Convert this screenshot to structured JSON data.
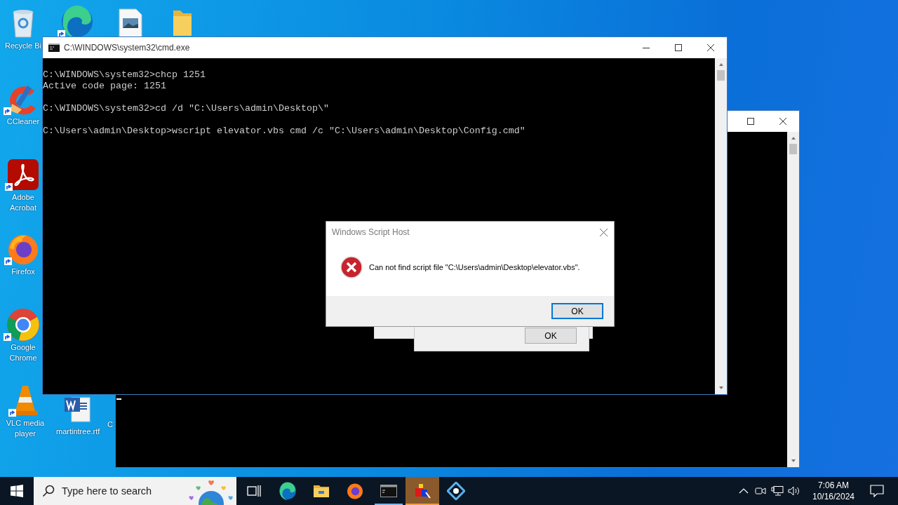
{
  "desktop_icons": [
    {
      "kind": "recycle-bin",
      "label": "Recycle Bi"
    },
    {
      "kind": "edge",
      "shortcut": true
    },
    {
      "kind": "image-file"
    },
    {
      "kind": "folder"
    },
    {
      "kind": "ccleaner",
      "label": "CCleaner",
      "shortcut": true
    },
    {
      "kind": "acrobat",
      "label": "Adobe Acrobat",
      "shortcut": true
    },
    {
      "kind": "firefox",
      "label": "Firefox",
      "shortcut": true
    },
    {
      "kind": "chrome",
      "label": "Google Chrome",
      "shortcut": true
    },
    {
      "kind": "vlc",
      "label": "VLC media player",
      "shortcut": true
    },
    {
      "kind": "word-file",
      "label": "martintree.rtf"
    },
    {
      "kind": "covered",
      "label": "C"
    }
  ],
  "cmd_window": {
    "title": "C:\\WINDOWS\\system32\\cmd.exe",
    "blocks": [
      [
        "C:\\WINDOWS\\system32>chcp 1251",
        "Active code page: 1251"
      ],
      [
        "C:\\WINDOWS\\system32>cd /d \"C:\\Users\\admin\\Desktop\\\""
      ],
      [
        "C:\\Users\\admin\\Desktop>wscript elevator.vbs cmd /c \"C:\\Users\\admin\\Desktop\\Config.cmd\""
      ]
    ]
  },
  "background_dialog": {
    "button": "OK"
  },
  "dialog": {
    "title": "Windows Script Host",
    "message": "Can not find script file \"C:\\Users\\admin\\Desktop\\elevator.vbs\".",
    "button": "OK"
  },
  "taskbar": {
    "search": {
      "placeholder": "Type here to search"
    },
    "apps": [
      {
        "kind": "task-view",
        "running": false,
        "selected": false
      },
      {
        "kind": "edge",
        "running": false,
        "selected": false
      },
      {
        "kind": "explorer",
        "running": false,
        "selected": false
      },
      {
        "kind": "firefox",
        "running": false,
        "selected": false
      },
      {
        "kind": "terminal",
        "running": true,
        "selected": false
      },
      {
        "kind": "blocks",
        "running": true,
        "selected": true
      },
      {
        "kind": "network-app",
        "running": false,
        "selected": false
      }
    ],
    "clock": {
      "time": "7:06 AM",
      "date": "10/16/2024"
    }
  }
}
